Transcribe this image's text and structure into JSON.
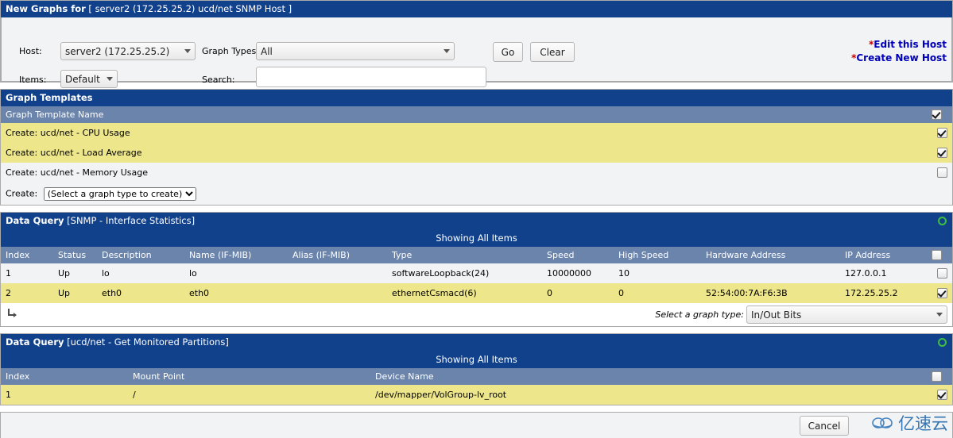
{
  "header": {
    "title_bold": "New Graphs for",
    "title_detail": "[ server2 (172.25.25.2) ucd/net SNMP Host ]"
  },
  "form": {
    "host_label": "Host:",
    "host_value": "server2 (172.25.25.2)",
    "items_label": "Items:",
    "items_value": "Default",
    "graph_types_label": "Graph Types:",
    "graph_types_value": "All",
    "search_label": "Search:",
    "search_value": "",
    "search_placeholder": "",
    "go_button": "Go",
    "clear_button": "Clear",
    "edit_host_link": "Edit this Host",
    "create_host_link": "Create New Host",
    "link_star": "*"
  },
  "graph_templates": {
    "section_title": "Graph Templates",
    "column_header": "Graph Template Name",
    "header_checkbox": true,
    "rows": [
      {
        "label": "Create: ucd/net - CPU Usage",
        "checked": true,
        "alt": true
      },
      {
        "label": "Create: ucd/net - Load Average",
        "checked": true,
        "alt": true
      },
      {
        "label": "Create: ucd/net - Memory Usage",
        "checked": false,
        "alt": false
      }
    ],
    "create_label": "Create:",
    "create_select_value": "(Select a graph type to create)"
  },
  "data_query_interface": {
    "section_title_bold": "Data Query",
    "section_title_detail": "[SNMP - Interface Statistics]",
    "showing": "Showing All Items",
    "columns": [
      "Index",
      "Status",
      "Description",
      "Name (IF-MIB)",
      "Alias (IF-MIB)",
      "Type",
      "Speed",
      "High Speed",
      "Hardware Address",
      "IP Address"
    ],
    "header_checkbox": false,
    "rows": [
      {
        "cells": [
          "1",
          "Up",
          "lo",
          "lo",
          "",
          "softwareLoopback(24)",
          "10000000",
          "10",
          "",
          "127.0.0.1"
        ],
        "checked": false,
        "alt": false
      },
      {
        "cells": [
          "2",
          "Up",
          "eth0",
          "eth0",
          "",
          "ethernetCsmacd(6)",
          "0",
          "0",
          "52:54:00:7A:F6:3B",
          "172.25.25.2"
        ],
        "checked": true,
        "alt": true
      }
    ],
    "graph_type_label": "Select a graph type:",
    "graph_type_value": "In/Out Bits"
  },
  "data_query_partitions": {
    "section_title_bold": "Data Query",
    "section_title_detail": "[ucd/net - Get Monitored Partitions]",
    "showing": "Showing All Items",
    "columns": [
      "Index",
      "Mount Point",
      "Device Name"
    ],
    "header_checkbox": false,
    "rows": [
      {
        "cells": [
          "1",
          "/",
          "/dev/mapper/VolGroup-lv_root"
        ],
        "checked": true,
        "alt": true
      }
    ]
  },
  "footer": {
    "cancel_button": "Cancel"
  },
  "watermark": {
    "text": "亿速云"
  },
  "colors": {
    "header_blue": "#12418C",
    "subheader_blue": "#6B84AC",
    "row_alt_yellow": "#EDE68A",
    "row_normal": "#F2F3F4",
    "link_blue": "#0000BB",
    "star_red": "#C00000",
    "green_ring": "#3FBF3F"
  }
}
